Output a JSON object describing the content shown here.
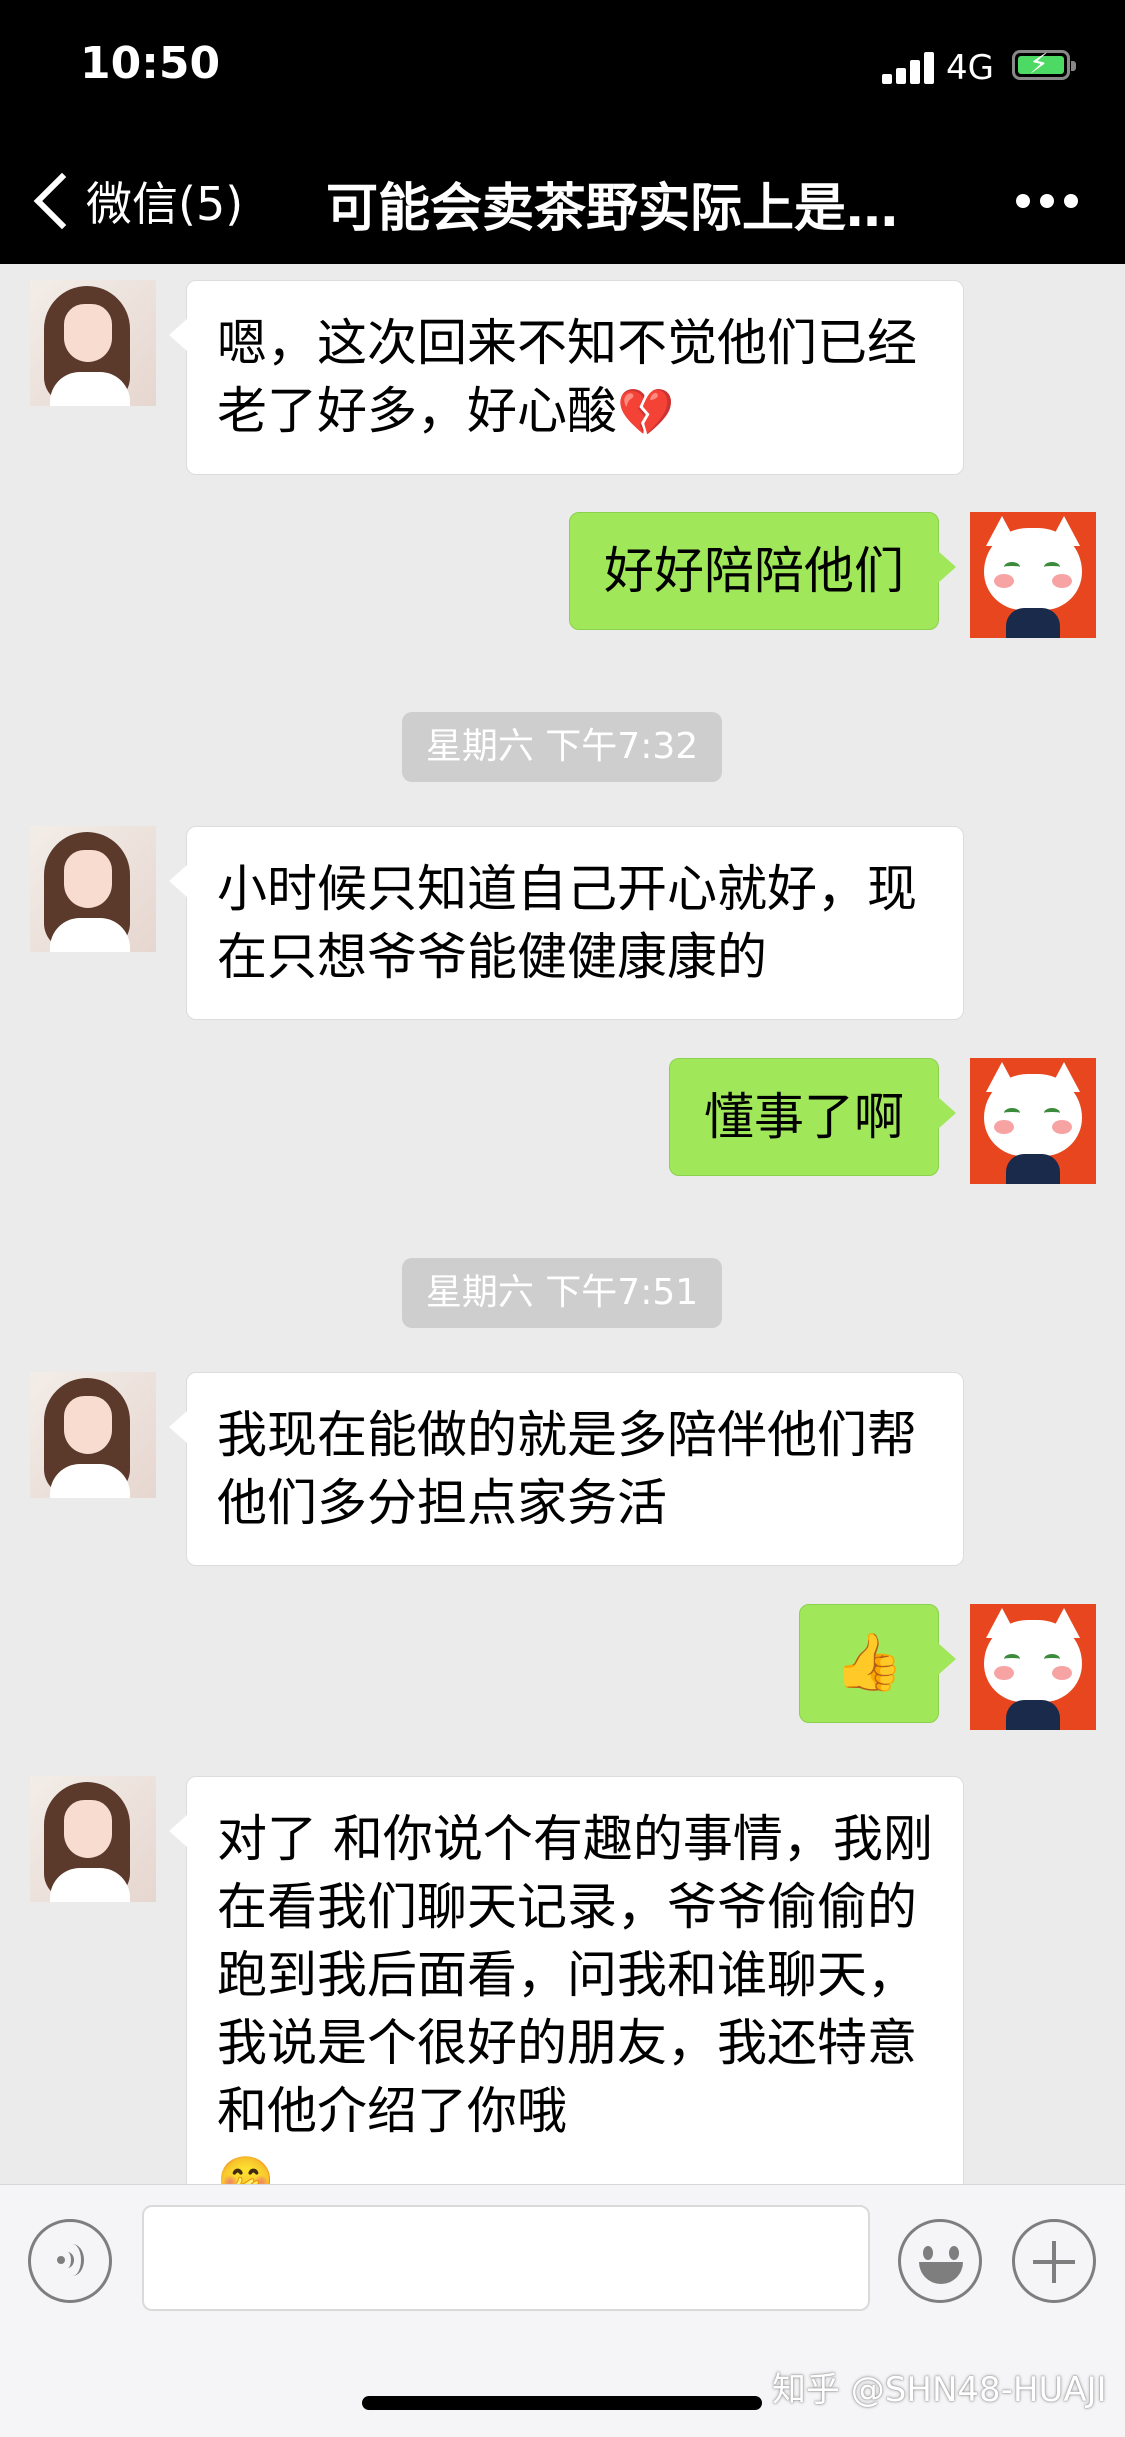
{
  "status_bar": {
    "time": "10:50",
    "network": "4G",
    "battery_charging": true,
    "battery_level": 0.85
  },
  "nav": {
    "back_label": "微信(5)",
    "title": "可能会卖茶野实际上是…"
  },
  "messages": [
    {
      "from": "contact",
      "text": "嗯，这次回来不知不觉他们已经老了好多，好心酸",
      "emoji": "💔"
    },
    {
      "from": "me",
      "text": "好好陪陪他们"
    },
    {
      "type": "timestamp",
      "text": "星期六 下午7:32"
    },
    {
      "from": "contact",
      "text": "小时候只知道自己开心就好，现在只想爷爷能健健康康的"
    },
    {
      "from": "me",
      "text": "懂事了啊"
    },
    {
      "type": "timestamp",
      "text": "星期六 下午7:51"
    },
    {
      "from": "contact",
      "text": "我现在能做的就是多陪伴他们帮他们多分担点家务活"
    },
    {
      "from": "me",
      "emoji": "👍"
    },
    {
      "from": "contact",
      "text": "对了 和你说个有趣的事情，我刚在看我们聊天记录，爷爷偷偷的跑到我后面看，问我和谁聊天，我说是个很好的朋友，我还特意和他介绍了你哦",
      "emoji": "🤭"
    }
  ],
  "input": {
    "value": "",
    "voice_icon": "voice-icon",
    "emoji_icon": "smiley-icon",
    "more_icon": "plus-icon"
  },
  "watermark": "知乎 @SHN48-HUAJI"
}
